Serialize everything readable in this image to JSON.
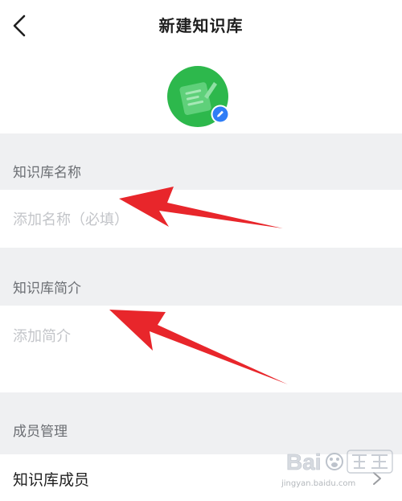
{
  "header": {
    "title": "新建知识库"
  },
  "sections": {
    "name_label": "知识库名称",
    "intro_label": "知识库简介",
    "members_label": "成员管理"
  },
  "fields": {
    "name_placeholder": "添加名称（必填）",
    "intro_placeholder": "添加简介"
  },
  "members_row": {
    "label": "知识库成员"
  },
  "watermark": {
    "text": "jingyan.baidu.com"
  },
  "colors": {
    "brand_green": "#2db84c",
    "badge_blue": "#2f7df6",
    "section_bg": "#eff0f2",
    "annotation_red": "#e8262b"
  }
}
